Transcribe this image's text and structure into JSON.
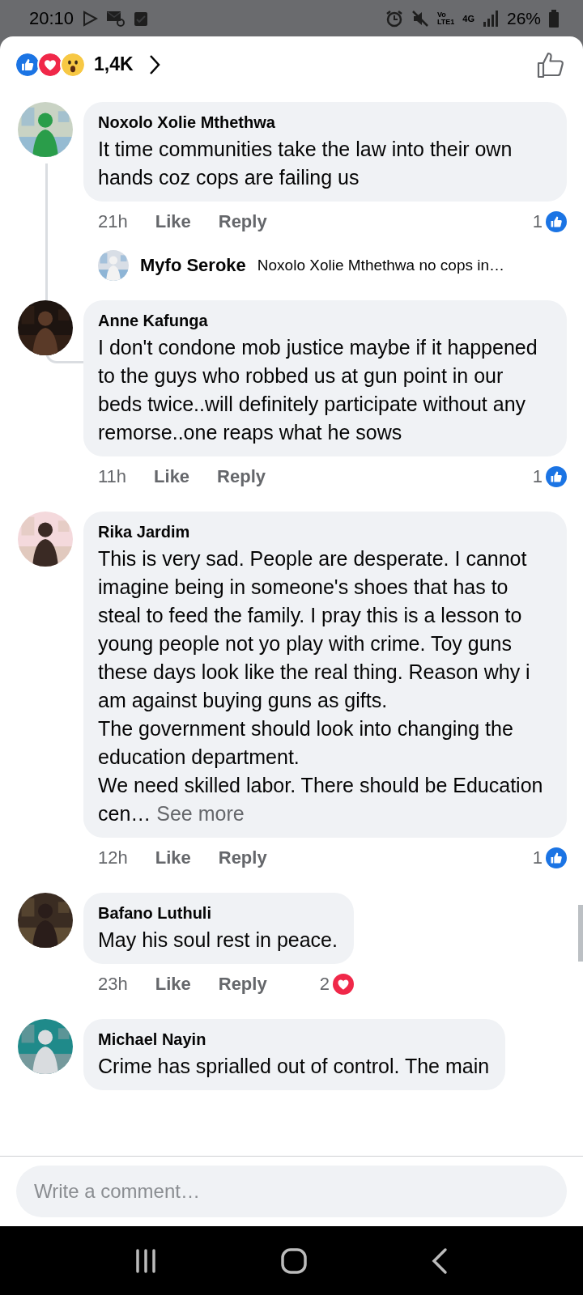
{
  "status_bar": {
    "time": "20:10",
    "volte_top": "Vo",
    "volte_bottom": "LTE1",
    "network": "4G",
    "battery": "26%"
  },
  "header": {
    "reaction_count": "1,4K"
  },
  "comments": [
    {
      "name": "Noxolo Xolie Mthethwa",
      "text": "It time communities take the law into their own hands coz cops are failing us",
      "time": "21h",
      "like": "Like",
      "reply": "Reply",
      "reaction": {
        "count": "1",
        "kind": "like"
      },
      "replies": [
        {
          "name": "Myfo Seroke",
          "text": "Noxolo Xolie Mthethwa no cops in…"
        }
      ]
    },
    {
      "name": "Anne Kafunga",
      "text": "I don't condone mob justice maybe if it happened to the guys who robbed us at gun point in our  beds twice..will definitely participate without any remorse..one reaps what he sows",
      "time": "11h",
      "like": "Like",
      "reply": "Reply",
      "reaction": {
        "count": "1",
        "kind": "like"
      }
    },
    {
      "name": "Rika Jardim",
      "text": "This is very sad. People are desperate. I cannot imagine being in someone's shoes that has to steal to feed the family. I pray this is a lesson to young people not yo play with crime.  Toy guns these days look like the real thing. Reason why i am against buying guns as gifts.\nThe government should look into changing the education department.\nWe need skilled labor.  There should be Education cen…",
      "see_more": "See more",
      "time": "12h",
      "like": "Like",
      "reply": "Reply",
      "reaction": {
        "count": "1",
        "kind": "like"
      }
    },
    {
      "name": "Bafano Luthuli",
      "text": "May his soul rest in peace.",
      "time": "23h",
      "like": "Like",
      "reply": "Reply",
      "reaction": {
        "count": "2",
        "kind": "love"
      }
    },
    {
      "name": "Michael Nayin",
      "text": "Crime has sprialled out of control. The main"
    }
  ],
  "composer": {
    "placeholder": "Write a comment…"
  }
}
